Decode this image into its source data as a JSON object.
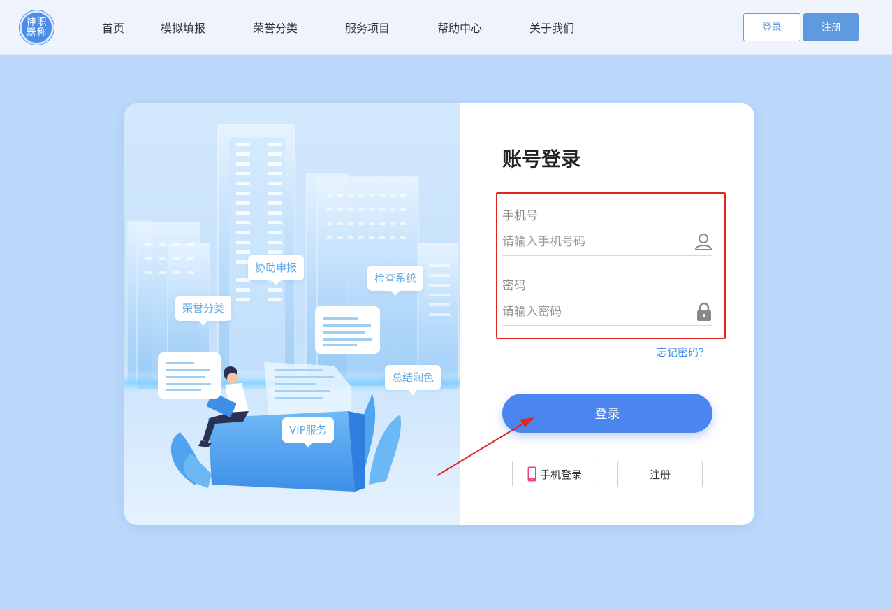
{
  "header": {
    "logo_text_line1": "神职",
    "logo_text_line2": "器称",
    "nav": [
      "首页",
      "模拟填报",
      "荣誉分类",
      "服务项目",
      "帮助中心",
      "关于我们"
    ],
    "login_label": "登录",
    "register_label": "注册"
  },
  "illustration": {
    "bubbles": [
      "协助申报",
      "检查系统",
      "荣誉分类",
      "总结润色",
      "VIP服务"
    ]
  },
  "form": {
    "title": "账号登录",
    "phone_label": "手机号",
    "phone_placeholder": "请输入手机号码",
    "password_label": "密码",
    "password_placeholder": "请输入密码",
    "forgot_label": "忘记密码？",
    "login_button": "登录",
    "phone_login_button": "手机登录",
    "register_button": "注册"
  },
  "colors": {
    "accent": "#4a86ee",
    "highlight_box": "#e0261f",
    "background": "#bcd9fb"
  }
}
